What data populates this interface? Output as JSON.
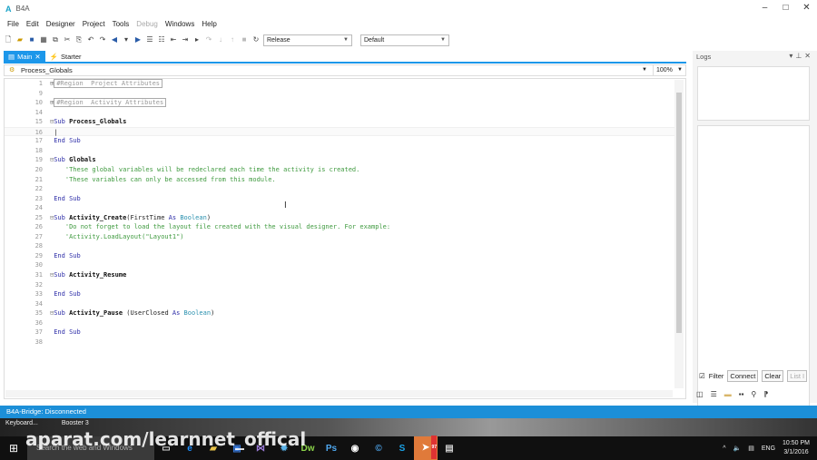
{
  "window": {
    "title": "B4A",
    "logo": "A"
  },
  "menu": [
    {
      "label": "File"
    },
    {
      "label": "Edit"
    },
    {
      "label": "Designer"
    },
    {
      "label": "Project"
    },
    {
      "label": "Tools"
    },
    {
      "label": "Debug",
      "disabled": true
    },
    {
      "label": "Windows"
    },
    {
      "label": "Help"
    }
  ],
  "toolbar": {
    "build_config": "Release",
    "device": "Default"
  },
  "tabs": [
    {
      "label": "Main",
      "active": true
    },
    {
      "label": "Starter"
    }
  ],
  "editor": {
    "procedure": "Process_Globals",
    "zoom": "100%",
    "lines": [
      {
        "n": "1",
        "parts": [
          [
            "fold",
            "⊞"
          ],
          [
            "rg",
            "#Region  Project Attributes"
          ]
        ]
      },
      {
        "n": "9",
        "parts": []
      },
      {
        "n": "10",
        "parts": [
          [
            "fold",
            "⊞"
          ],
          [
            "rg",
            "#Region  Activity Attributes"
          ]
        ]
      },
      {
        "n": "14",
        "parts": []
      },
      {
        "n": "15",
        "parts": [
          [
            "fold",
            "⊟"
          ],
          [
            "kw",
            "Sub "
          ],
          [
            "nm",
            "Process_Globals"
          ]
        ]
      },
      {
        "n": "16",
        "parts": [
          [
            "tx",
            " |"
          ]
        ],
        "current": true
      },
      {
        "n": "17",
        "parts": [
          [
            "kw",
            " End Sub"
          ]
        ]
      },
      {
        "n": "18",
        "parts": []
      },
      {
        "n": "19",
        "parts": [
          [
            "fold",
            "⊟"
          ],
          [
            "kw",
            "Sub "
          ],
          [
            "nm",
            "Globals"
          ]
        ]
      },
      {
        "n": "20",
        "parts": [
          [
            "cm",
            "    'These global variables will be redeclared each time the activity is created."
          ]
        ]
      },
      {
        "n": "21",
        "parts": [
          [
            "cm",
            "    'These variables can only be accessed from this module."
          ]
        ]
      },
      {
        "n": "22",
        "parts": []
      },
      {
        "n": "23",
        "parts": [
          [
            "kw",
            " End Sub"
          ]
        ]
      },
      {
        "n": "24",
        "parts": []
      },
      {
        "n": "25",
        "parts": [
          [
            "fold",
            "⊟"
          ],
          [
            "kw",
            "Sub "
          ],
          [
            "nm",
            "Activity_Create"
          ],
          [
            "tx",
            "(FirstTime "
          ],
          [
            "kw",
            "As "
          ],
          [
            "ty",
            "Boolean"
          ],
          [
            "tx",
            ")"
          ]
        ]
      },
      {
        "n": "26",
        "parts": [
          [
            "cm",
            "    'Do not forget to load the layout file created with the visual designer. For example:"
          ]
        ]
      },
      {
        "n": "27",
        "parts": [
          [
            "cm",
            "    'Activity.LoadLayout(\"Layout1\")"
          ]
        ]
      },
      {
        "n": "28",
        "parts": []
      },
      {
        "n": "29",
        "parts": [
          [
            "kw",
            " End Sub"
          ]
        ]
      },
      {
        "n": "30",
        "parts": []
      },
      {
        "n": "31",
        "parts": [
          [
            "fold",
            "⊟"
          ],
          [
            "kw",
            "Sub "
          ],
          [
            "nm",
            "Activity_Resume"
          ]
        ]
      },
      {
        "n": "32",
        "parts": []
      },
      {
        "n": "33",
        "parts": [
          [
            "kw",
            " End Sub"
          ]
        ]
      },
      {
        "n": "34",
        "parts": []
      },
      {
        "n": "35",
        "parts": [
          [
            "fold",
            "⊟"
          ],
          [
            "kw",
            "Sub "
          ],
          [
            "nm",
            "Activity_Pause"
          ],
          [
            "tx",
            " (UserClosed "
          ],
          [
            "kw",
            "As "
          ],
          [
            "ty",
            "Boolean"
          ],
          [
            "tx",
            ")"
          ]
        ]
      },
      {
        "n": "36",
        "parts": []
      },
      {
        "n": "37",
        "parts": [
          [
            "kw",
            " End Sub"
          ]
        ]
      },
      {
        "n": "38",
        "parts": []
      }
    ]
  },
  "logs": {
    "title": "Logs",
    "filter_label": "Filter",
    "filter_checked": true,
    "connect": "Connect",
    "clear": "Clear",
    "list": "List I"
  },
  "status": "B4A-Bridge: Disconnected",
  "desktop": {
    "icons": [
      "Keyboard...",
      "Booster 3"
    ]
  },
  "taskbar": {
    "search": "Search the web and Windows",
    "lang": "ENG",
    "time": "10:50 PM",
    "date": "3/1/2016",
    "badge": "97"
  },
  "watermark": "aparat.com/learnnet_offical",
  "colors": {
    "accent": "#1c97ea",
    "status_bar": "#1c8fd8",
    "keyword": "#2e2ea8",
    "comment": "#3f9a3f",
    "type": "#2b91af"
  }
}
